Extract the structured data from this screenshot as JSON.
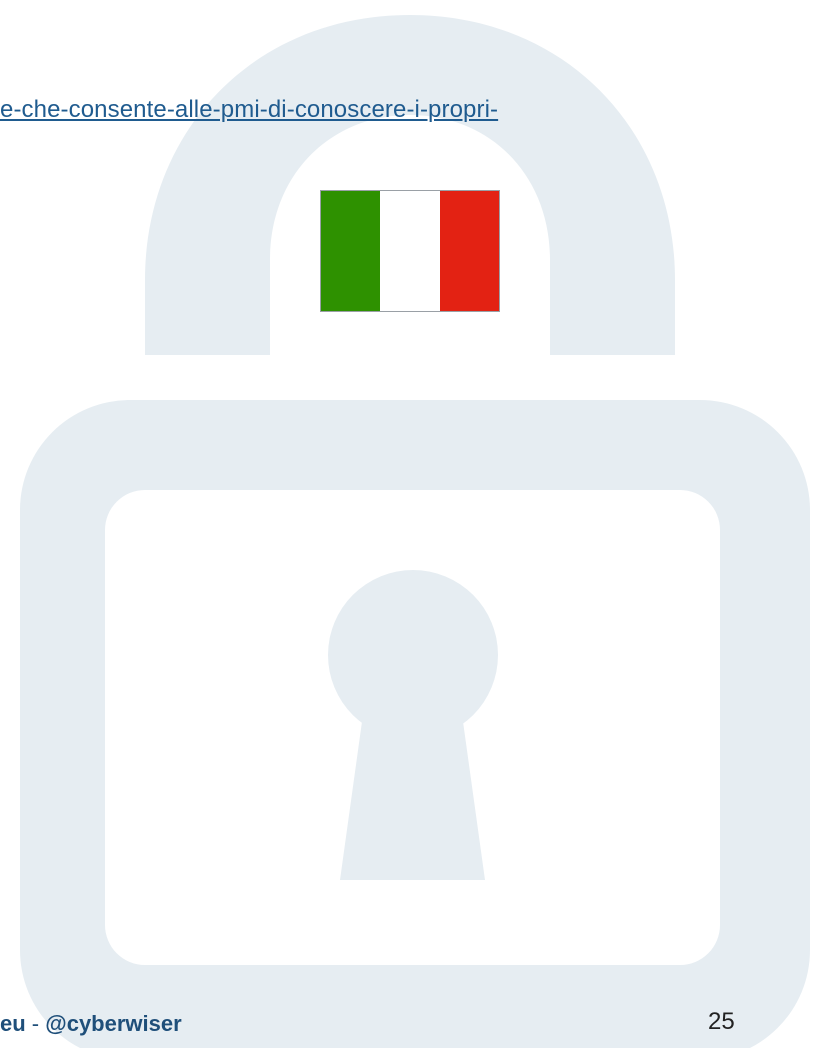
{
  "link_fragment": "e-che-consente-alle-pmi-di-conoscere-i-propri-",
  "flag": {
    "name": "italy-flag",
    "colors": [
      "#2e9100",
      "#ffffff",
      "#e32213"
    ]
  },
  "footer": {
    "site_fragment": "eu",
    "separator": " - ",
    "handle": "@cyberwiser"
  },
  "page_number": "25",
  "colors": {
    "watermark": "#e6edf2",
    "link": "#1f5b8f",
    "footer_text": "#1f4f7a"
  }
}
